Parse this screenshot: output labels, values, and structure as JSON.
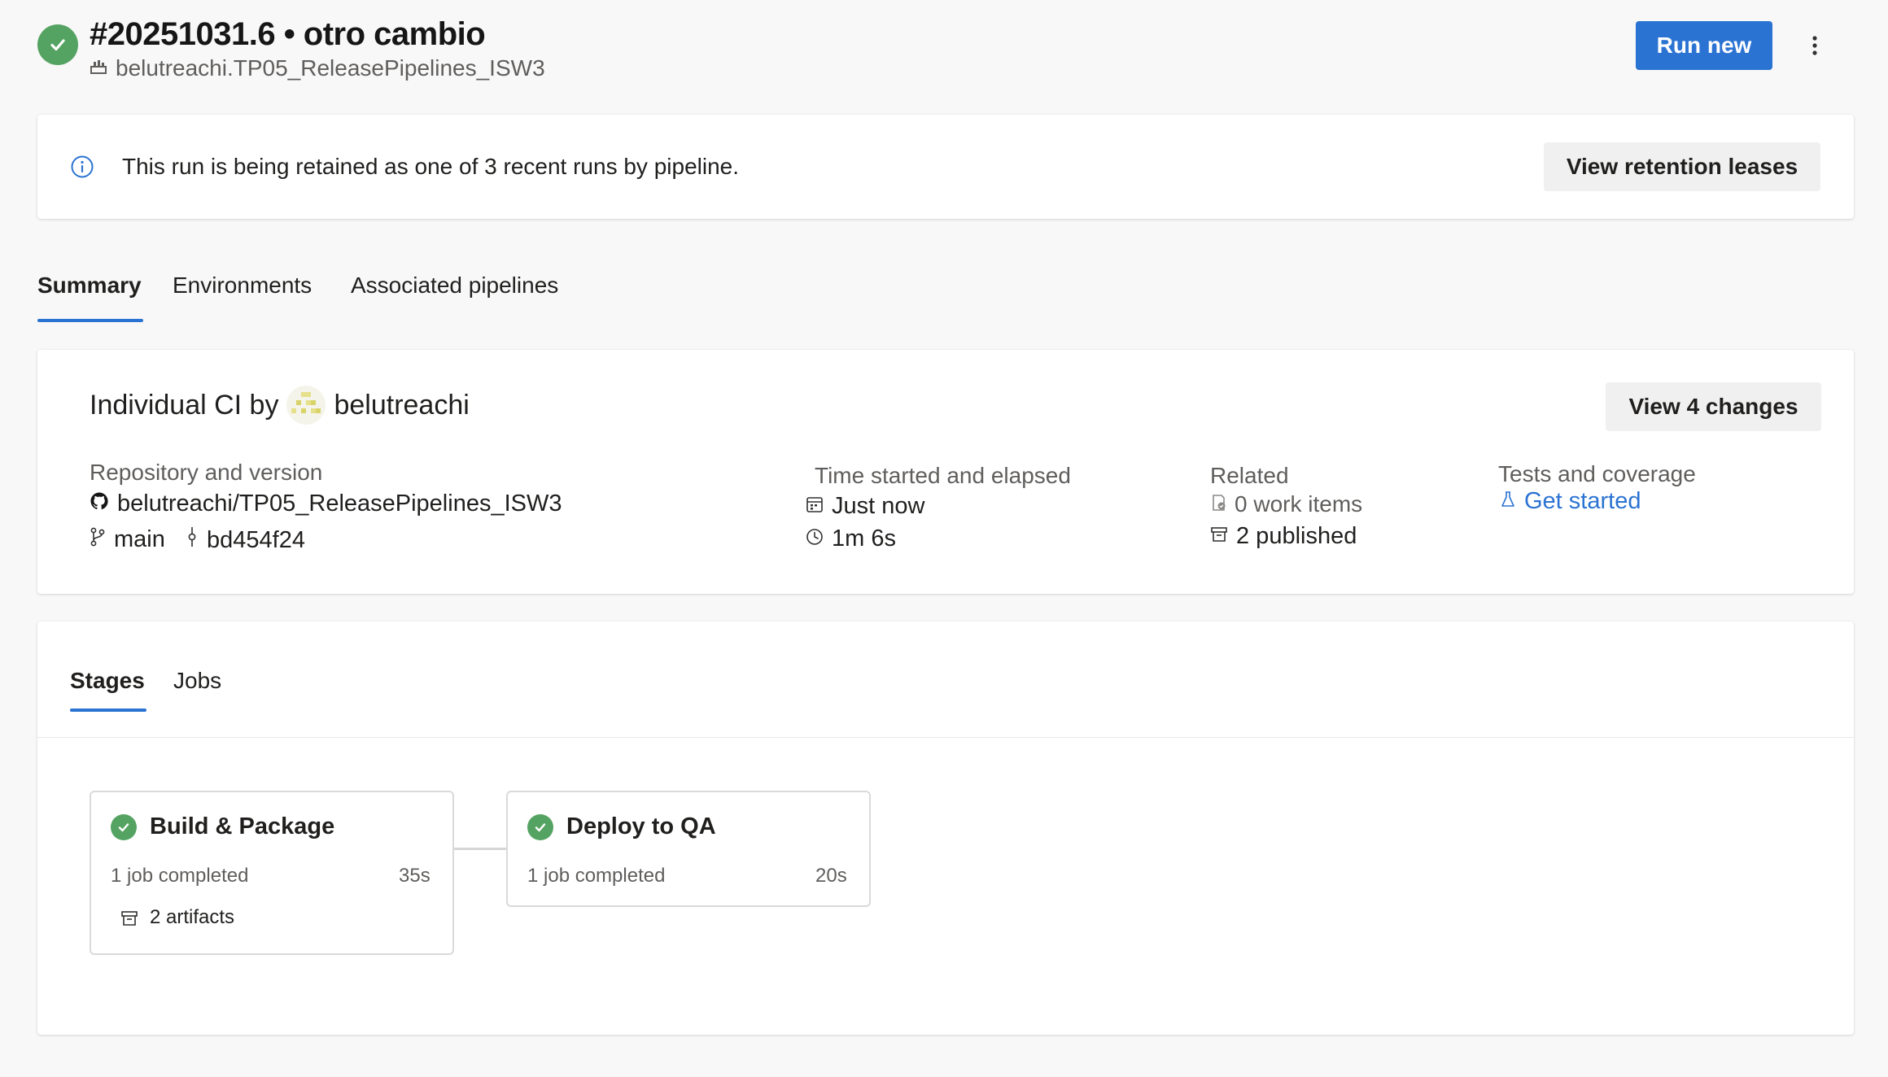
{
  "header": {
    "run_title": "#20251031.6 • otro cambio",
    "pipeline_name": "belutreachi.TP05_ReleasePipelines_ISW3",
    "run_new_label": "Run new"
  },
  "retention": {
    "message": "This run is being retained as one of 3 recent runs by pipeline.",
    "button_label": "View retention leases"
  },
  "tabs": [
    {
      "label": "Summary",
      "active": true
    },
    {
      "label": "Environments",
      "active": false
    },
    {
      "label": "Associated pipelines",
      "active": false
    }
  ],
  "summary": {
    "trigger_prefix": "Individual CI by",
    "user": "belutreachi",
    "view_changes_label": "View 4 changes",
    "repo": {
      "label": "Repository and version",
      "name": "belutreachi/TP05_ReleasePipelines_ISW3",
      "branch": "main",
      "commit": "bd454f24"
    },
    "time": {
      "label": "Time started and elapsed",
      "started": "Just now",
      "elapsed": "1m 6s"
    },
    "related": {
      "label": "Related",
      "work_items": "0 work items",
      "published": "2 published"
    },
    "tests": {
      "label": "Tests and coverage",
      "link": "Get started"
    }
  },
  "stage_tabs": [
    {
      "label": "Stages",
      "active": true
    },
    {
      "label": "Jobs",
      "active": false
    }
  ],
  "stages": [
    {
      "name": "Build & Package",
      "jobs": "1 job completed",
      "duration": "35s",
      "artifacts": "2 artifacts",
      "status": "succeeded"
    },
    {
      "name": "Deploy to QA",
      "jobs": "1 job completed",
      "duration": "20s",
      "status": "succeeded"
    }
  ],
  "colors": {
    "accent": "#2b73d2",
    "success": "#55a362",
    "page_bg": "#f8f8f8"
  }
}
